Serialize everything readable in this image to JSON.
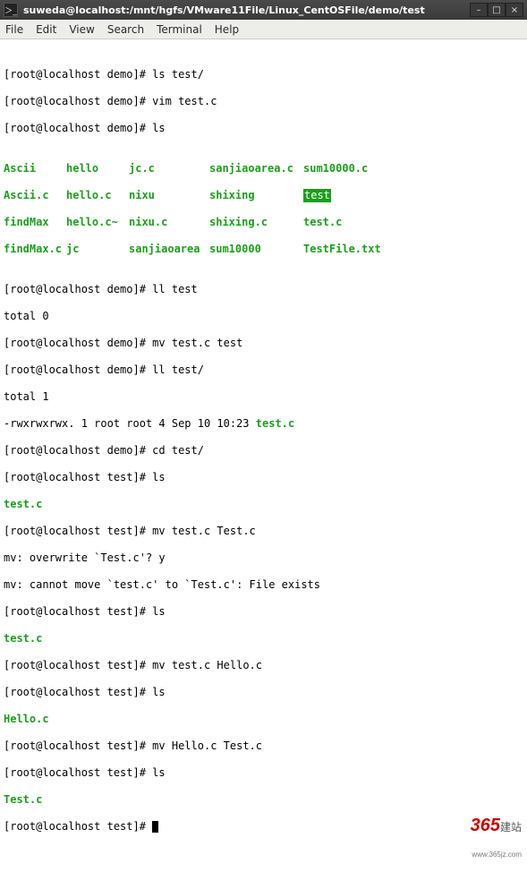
{
  "window": {
    "title": "suweda@localhost:/mnt/hgfs/VMware11File/Linux_CentOSFile/demo/test",
    "min": "–",
    "max": "□",
    "close": "×"
  },
  "menubar": {
    "file": "File",
    "edit": "Edit",
    "view": "View",
    "search": "Search",
    "terminal": "Terminal",
    "help": "Help"
  },
  "prompts": {
    "demo": "[root@localhost demo]# ",
    "test": "[root@localhost test]# "
  },
  "commands": {
    "ls_test_dir": "ls test/",
    "vim_testc": "vim test.c",
    "ls": "ls",
    "ll_test": "ll test",
    "mv_testc_test": "mv test.c test",
    "ll_test_dir": "ll test/",
    "cd_test": "cd test/",
    "mv_testc_Testc": "mv test.c Test.c",
    "mv_testc_Helloc": "mv test.c Hello.c",
    "mv_Helloc_Testc": "mv Hello.c Test.c"
  },
  "ls_columns": {
    "r0": {
      "c0": "Ascii",
      "c1": "hello",
      "c2": "jc.c",
      "c3": "sanjiaoarea.c",
      "c4": "sum10000.c"
    },
    "r1": {
      "c0": "Ascii.c",
      "c1": "hello.c",
      "c2": "nixu",
      "c3": "shixing",
      "c4": "test"
    },
    "r2": {
      "c0": "findMax",
      "c1": "hello.c~",
      "c2": "nixu.c",
      "c3": "shixing.c",
      "c4": "test.c"
    },
    "r3": {
      "c0": "findMax.c",
      "c1": "jc",
      "c2": "sanjiaoarea",
      "c3": "sum10000",
      "c4": "TestFile.txt"
    }
  },
  "output": {
    "total0": "total 0",
    "total1": "total 1",
    "ll_line": "-rwxrwxrwx. 1 root root 4 Sep 10 10:23 ",
    "ll_file": "test.c",
    "testc": "test.c",
    "overwrite": "mv: overwrite `Test.c'? y",
    "cannot_move": "mv: cannot move `test.c' to `Test.c': File exists",
    "Testc": "Test.c",
    "Helloc": "Hello.c"
  },
  "watermark": {
    "num": "365",
    "cn": "建站",
    "sub": "www.365jz.com"
  }
}
